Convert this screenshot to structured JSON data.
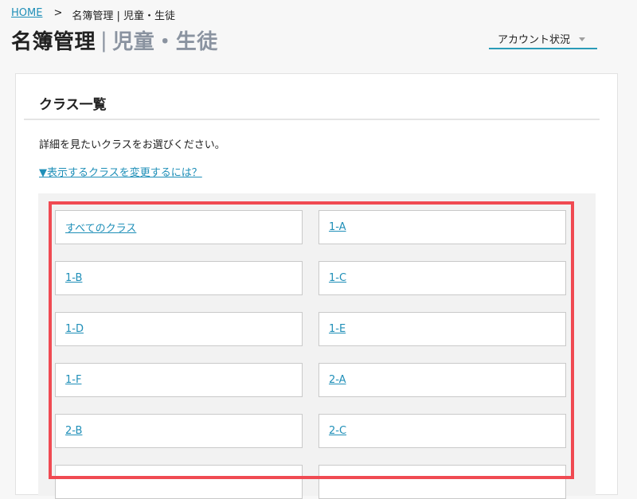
{
  "breadcrumb": {
    "home": "HOME",
    "separator": ">",
    "current": "名簿管理 | 児童・生徒"
  },
  "header": {
    "title_main": "名簿管理",
    "title_bar": "|",
    "title_sub": "児童・生徒"
  },
  "account": {
    "label": "アカウント状況",
    "icon": "caret-down-icon"
  },
  "card": {
    "title": "クラス一覧",
    "instruction": "詳細を見たいクラスをお選びください。",
    "help_link": "▼表示するクラスを変更するには？"
  },
  "classes": [
    "すべてのクラス",
    "1-A",
    "1-B",
    "1-C",
    "1-D",
    "1-E",
    "1-F",
    "2-A",
    "2-B",
    "2-C",
    "",
    ""
  ],
  "colors": {
    "link": "#1f8fb8",
    "accent": "#2a9bb8",
    "highlight": "#f04a52"
  }
}
